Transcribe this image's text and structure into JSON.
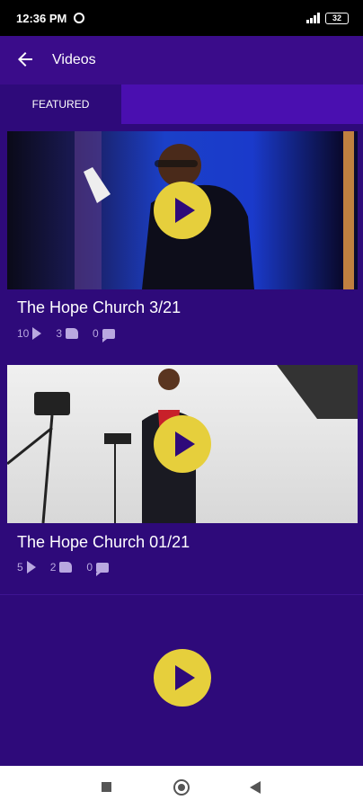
{
  "status_bar": {
    "time": "12:36 PM",
    "battery": "32"
  },
  "app_bar": {
    "title": "Videos"
  },
  "tabs": [
    {
      "label": "FEATURED"
    },
    {
      "label": ""
    },
    {
      "label": ""
    }
  ],
  "videos": [
    {
      "title": "The Hope Church 3/21",
      "views": "10",
      "likes": "3",
      "comments": "0"
    },
    {
      "title": "The Hope Church 01/21",
      "views": "5",
      "likes": "2",
      "comments": "0"
    }
  ],
  "colors": {
    "background": "#2e0a7a",
    "accent": "#e6cf3c"
  }
}
